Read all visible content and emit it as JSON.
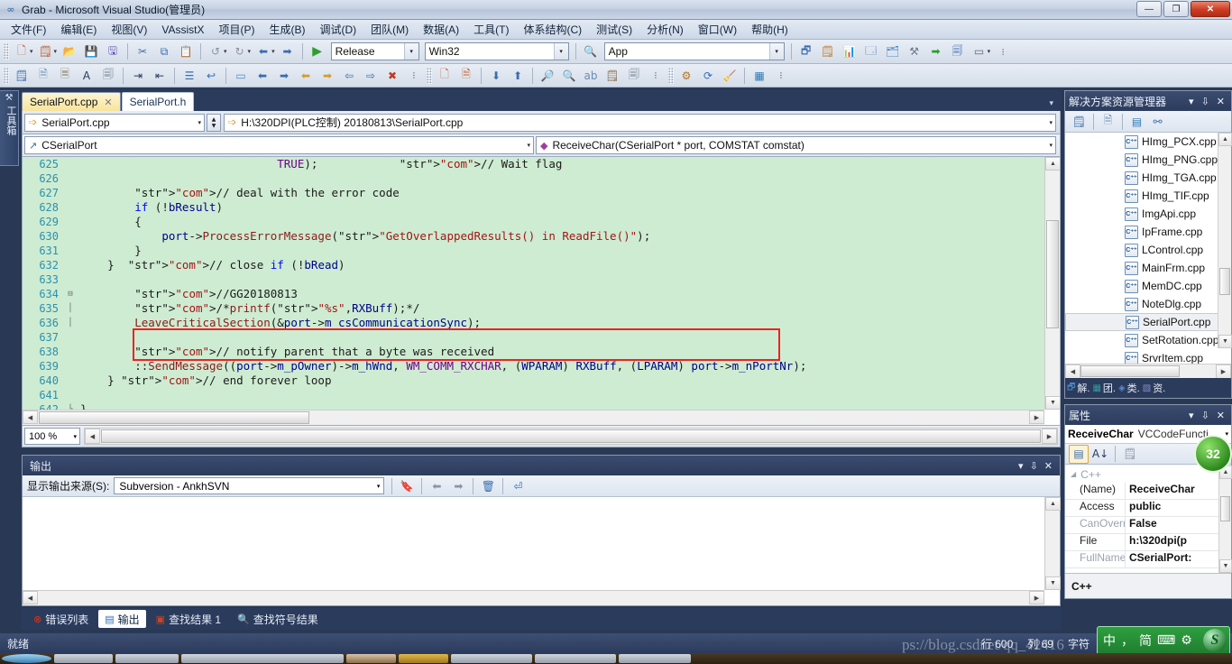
{
  "window": {
    "title": "Grab - Microsoft Visual Studio(管理员)",
    "app_icon": "vs-infinity-icon",
    "minimize": "—",
    "restore": "❐",
    "close": "✕"
  },
  "menu": [
    {
      "label": "文件(F)"
    },
    {
      "label": "编辑(E)"
    },
    {
      "label": "视图(V)"
    },
    {
      "label": "VAssistX"
    },
    {
      "label": "项目(P)"
    },
    {
      "label": "生成(B)"
    },
    {
      "label": "调试(D)"
    },
    {
      "label": "团队(M)"
    },
    {
      "label": "数据(A)"
    },
    {
      "label": "工具(T)"
    },
    {
      "label": "体系结构(C)"
    },
    {
      "label": "测试(S)"
    },
    {
      "label": "分析(N)"
    },
    {
      "label": "窗口(W)"
    },
    {
      "label": "帮助(H)"
    }
  ],
  "toolbar": {
    "config": "Release",
    "platform": "Win32",
    "startup": "App",
    "run_label": "▶"
  },
  "toolbox_tab": {
    "label": "工具箱",
    "icon": "toolbox-icon"
  },
  "editor": {
    "tabs": [
      {
        "label": "SerialPort.cpp",
        "active": true,
        "close": "✕"
      },
      {
        "label": "SerialPort.h",
        "active": false
      }
    ],
    "nav_project": "SerialPort.cpp",
    "nav_path": "H:\\320DPI(PLC控制) 20180813\\SerialPort.cpp",
    "nav_class": "CSerialPort",
    "nav_member": "ReceiveChar(CSerialPort * port, COMSTAT comstat)",
    "zoom": "100 %",
    "lines": [
      {
        "num": "625",
        "fold": "",
        "text": "                             TRUE);            // Wait flag"
      },
      {
        "num": "626",
        "fold": "",
        "text": ""
      },
      {
        "num": "627",
        "fold": "",
        "text": "        // deal with the error code"
      },
      {
        "num": "628",
        "fold": "",
        "text": "        if (!bResult)"
      },
      {
        "num": "629",
        "fold": "",
        "text": "        {"
      },
      {
        "num": "630",
        "fold": "",
        "text": "            port->ProcessErrorMessage(\"GetOverlappedResults() in ReadFile()\");"
      },
      {
        "num": "631",
        "fold": "",
        "text": "        }"
      },
      {
        "num": "632",
        "fold": "",
        "text": "    }  // close if (!bRead)"
      },
      {
        "num": "633",
        "fold": "",
        "text": ""
      },
      {
        "num": "634",
        "fold": "⊟",
        "text": "        //GG20180813"
      },
      {
        "num": "635",
        "fold": "│",
        "text": "        /*printf(\"%s\",RXBuff);*/"
      },
      {
        "num": "636",
        "fold": "│",
        "text": "        LeaveCriticalSection(&port->m_csCommunicationSync);"
      },
      {
        "num": "637",
        "fold": "",
        "text": ""
      },
      {
        "num": "638",
        "fold": "",
        "text": "        // notify parent that a byte was received"
      },
      {
        "num": "639",
        "fold": "",
        "text": "        ::SendMessage((port->m_pOwner)->m_hWnd, WM_COMM_RXCHAR, (WPARAM) RXBuff, (LPARAM) port->m_nPortNr);"
      },
      {
        "num": "640",
        "fold": "",
        "text": "    } // end forever loop"
      },
      {
        "num": "641",
        "fold": "",
        "text": ""
      },
      {
        "num": "642",
        "fold": "└",
        "text": "}"
      }
    ],
    "highlight_note": "red-rectangle-annotation around lines 638-639"
  },
  "output": {
    "title": "输出",
    "source_label": "显示输出来源(S):",
    "source_value": "Subversion - AnkhSVN",
    "body_text": ""
  },
  "bottom_tabs": [
    {
      "label": "错误列表",
      "icon": "error-list-icon",
      "active": false
    },
    {
      "label": "输出",
      "icon": "output-icon",
      "active": true
    },
    {
      "label": "查找结果 1",
      "icon": "find-results-icon",
      "active": false
    },
    {
      "label": "查找符号结果",
      "icon": "find-symbol-results-icon",
      "active": false
    }
  ],
  "solution_explorer": {
    "title": "解决方案资源管理器",
    "items": [
      {
        "label": "HImg_PCX.cpp",
        "selected": false
      },
      {
        "label": "HImg_PNG.cpp",
        "selected": false
      },
      {
        "label": "HImg_TGA.cpp",
        "selected": false
      },
      {
        "label": "HImg_TIF.cpp",
        "selected": false
      },
      {
        "label": "ImgApi.cpp",
        "selected": false
      },
      {
        "label": "IpFrame.cpp",
        "selected": false
      },
      {
        "label": "LControl.cpp",
        "selected": false
      },
      {
        "label": "MainFrm.cpp",
        "selected": false
      },
      {
        "label": "MemDC.cpp",
        "selected": false
      },
      {
        "label": "NoteDlg.cpp",
        "selected": false
      },
      {
        "label": "SerialPort.cpp",
        "selected": true
      },
      {
        "label": "SetRotation.cpp",
        "selected": false
      },
      {
        "label": "SrvrItem.cpp",
        "selected": false
      }
    ],
    "dock_tabs": [
      {
        "label": "解.",
        "icon": "solution-explorer-icon"
      },
      {
        "label": "团.",
        "icon": "team-explorer-icon"
      },
      {
        "label": "类.",
        "icon": "class-view-icon"
      },
      {
        "label": "资.",
        "icon": "resource-view-icon"
      }
    ]
  },
  "properties": {
    "title": "属性",
    "object_name": "ReceiveChar",
    "object_type": "VCCodeFuncti",
    "category": "C++",
    "rows": [
      {
        "key": "(Name)",
        "value": "ReceiveChar",
        "dim": false
      },
      {
        "key": "Access",
        "value": "public",
        "dim": false
      },
      {
        "key": "CanOverri",
        "value": "False",
        "dim": true
      },
      {
        "key": "File",
        "value": "h:\\320dpi(p",
        "dim": false
      },
      {
        "key": "FullName",
        "value": "CSerialPort:",
        "dim": true
      }
    ],
    "description": "C++"
  },
  "badge": {
    "text": "32"
  },
  "statusbar": {
    "ready": "就绪",
    "line_label": "行",
    "line_value": "600",
    "col_label": "列",
    "col_value": "69",
    "char_label": "字符"
  },
  "watermark": {
    "text": "ps://blog.csdnet/qq_42416"
  },
  "ime": {
    "mode": "中",
    "punct": "，",
    "shape": "简",
    "keyboard_icon": "keyboard-icon",
    "tools_icon": "gear-icon",
    "logo": "S"
  },
  "colors": {
    "title_bg": "#c4d0e2",
    "code_bg": "#ceecd2",
    "accent_red": "#ee2222",
    "dock_header": "#2c3c5d",
    "tab_active": "#f8e49b",
    "ime_green": "#2d9f3f"
  }
}
